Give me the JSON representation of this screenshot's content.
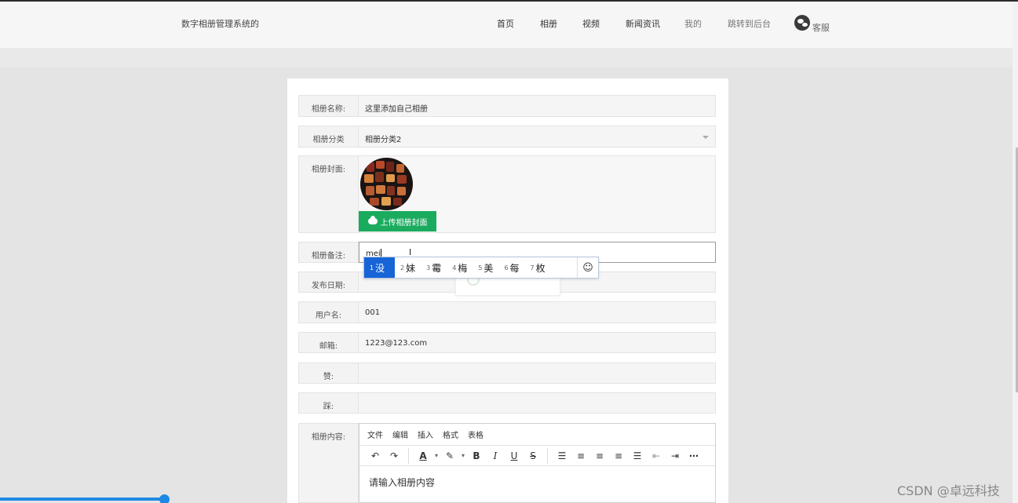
{
  "navbar": {
    "site_title": "数字相册管理系统的",
    "items": [
      "首页",
      "相册",
      "视频",
      "新闻资讯",
      "我的",
      "跳转到后台"
    ],
    "service": "客服"
  },
  "form": {
    "name": {
      "label": "相册名称:",
      "value": "这里添加自己相册"
    },
    "category": {
      "label": "相册分类",
      "value": "相册分类2"
    },
    "cover": {
      "label": "相册封面:",
      "upload_label": "上传相册封面"
    },
    "remark": {
      "label": "相册备注:",
      "value": "mei"
    },
    "publish_date": {
      "label": "发布日期:",
      "value": ""
    },
    "username": {
      "label": "用户名:",
      "value": "001"
    },
    "email": {
      "label": "邮箱:",
      "value": "1223@123.com"
    },
    "likes": {
      "label": "赞:",
      "value": ""
    },
    "dislikes": {
      "label": "踩:",
      "value": ""
    },
    "content": {
      "label": "相册内容:",
      "placeholder": "请输入相册内容"
    }
  },
  "ime": {
    "candidates": [
      {
        "num": "1",
        "char": "没"
      },
      {
        "num": "2",
        "char": "妹"
      },
      {
        "num": "3",
        "char": "霉"
      },
      {
        "num": "4",
        "char": "梅"
      },
      {
        "num": "5",
        "char": "美"
      },
      {
        "num": "6",
        "char": "每"
      },
      {
        "num": "7",
        "char": "枚"
      }
    ],
    "emoji": "☺"
  },
  "editor": {
    "menus": [
      "文件",
      "编辑",
      "插入",
      "格式",
      "表格"
    ]
  },
  "watermark": "CSDN @卓远科技",
  "colors": {
    "upload_button": "#1aab5f",
    "ime_selected": "#1764d6",
    "video_progress": "#1e88e5"
  }
}
